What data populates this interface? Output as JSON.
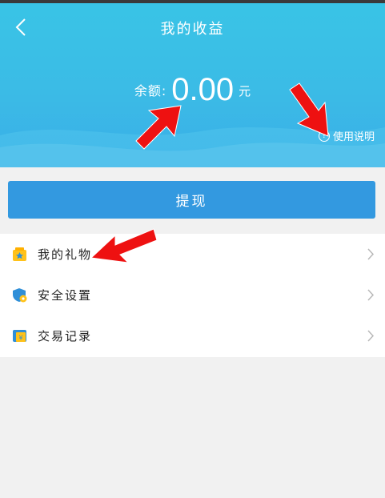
{
  "header": {
    "title": "我的收益"
  },
  "balance": {
    "label": "余额:",
    "amount": "0.00",
    "unit": "元"
  },
  "help": {
    "label": "使用说明",
    "icon": "question-circle-icon"
  },
  "withdraw": {
    "label": "提现"
  },
  "menu": {
    "items": [
      {
        "label": "我的礼物",
        "icon": "gift-icon"
      },
      {
        "label": "安全设置",
        "icon": "shield-icon"
      },
      {
        "label": "交易记录",
        "icon": "transaction-record-icon"
      }
    ]
  },
  "colors": {
    "header_top": "#39c4e6",
    "header_bottom": "#3aaee8",
    "button": "#3399e0",
    "page_bg": "#f1f1f1",
    "annotation_arrow": "#ee1111"
  }
}
